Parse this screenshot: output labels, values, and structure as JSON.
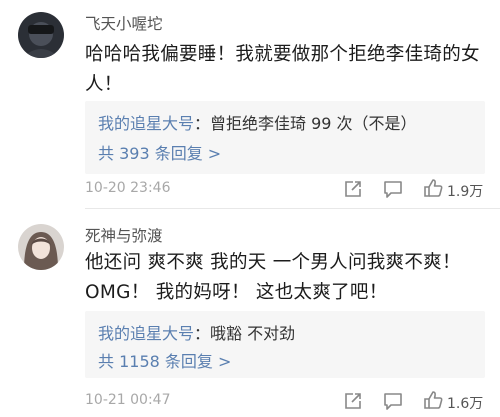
{
  "comments": [
    {
      "username": "飞天小喔坨",
      "content": "哈哈哈我偏要睡！我就要做那个拒绝李佳琦的女人！",
      "reply": {
        "author": "我的追星大号",
        "text": "：曾拒绝李佳琦 99 次（不是）"
      },
      "reply_count": "共 393 条回复 >",
      "time": "10-20 23:46",
      "likes": "1.9万"
    },
    {
      "username": "死神与弥渡",
      "content_lines": [
        "他还问 爽不爽 我的天 一个男人问我爽不爽！",
        "OMG！ 我的妈呀！ 这也太爽了吧！"
      ],
      "reply": {
        "author": "我的追星大号",
        "text": "：哦豁 不对劲"
      },
      "reply_count": "共 1158 条回复 >",
      "time": "10-21 00:47",
      "likes": "1.6万"
    }
  ],
  "icons": {
    "share": "share-icon",
    "comment": "comment-icon",
    "like": "thumbs-up-icon"
  }
}
